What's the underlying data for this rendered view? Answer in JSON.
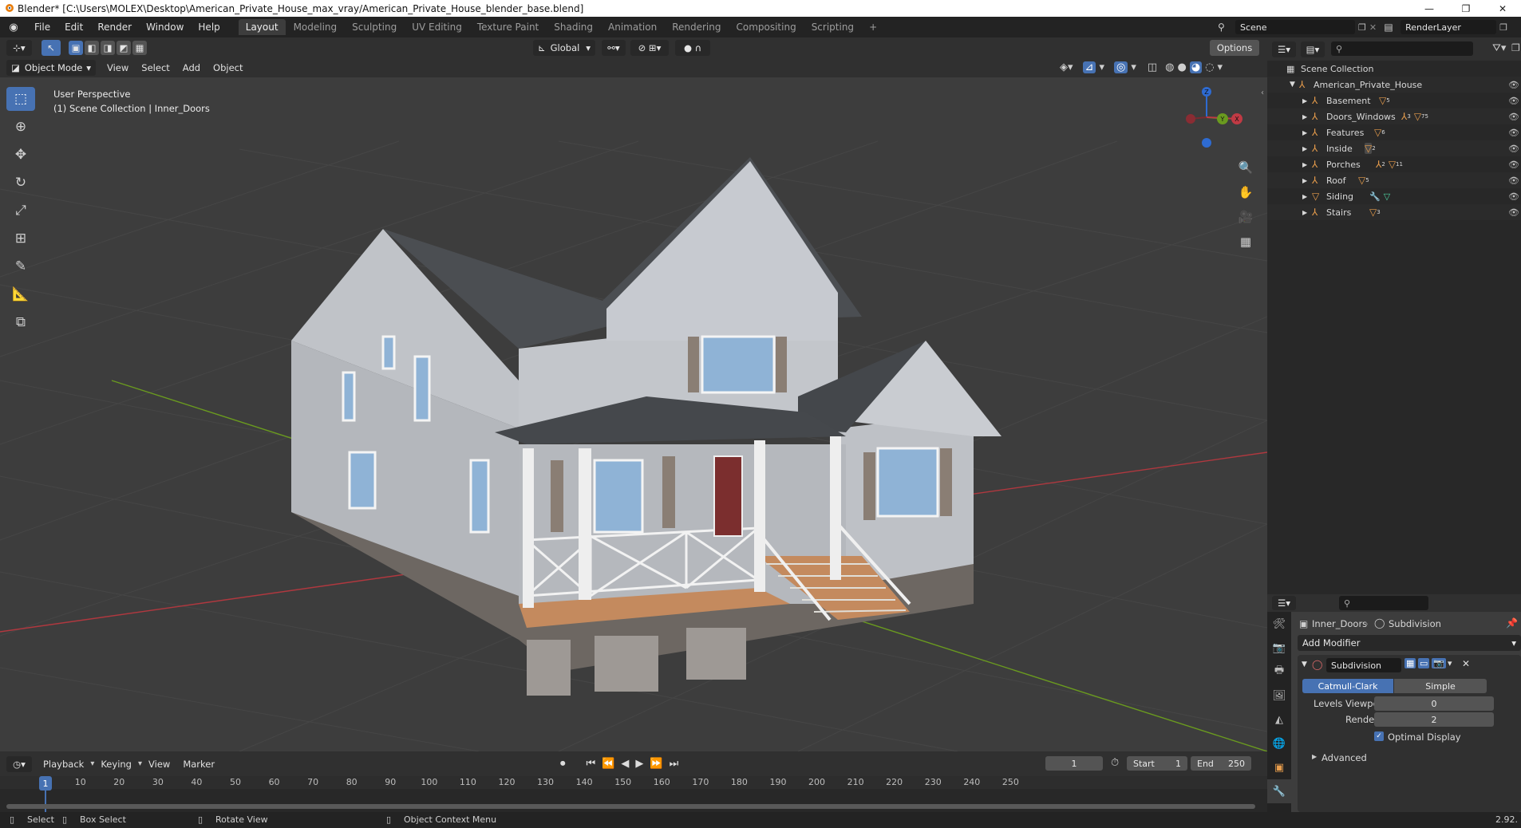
{
  "window": {
    "title": "Blender* [C:\\Users\\MOLEX\\Desktop\\American_Private_House_max_vray/American_Private_House_blender_base.blend]",
    "controls": [
      "—",
      "❐",
      "✕"
    ]
  },
  "menubar": {
    "items": [
      "File",
      "Edit",
      "Render",
      "Window",
      "Help"
    ],
    "workspaces": [
      "Layout",
      "Modeling",
      "Sculpting",
      "UV Editing",
      "Texture Paint",
      "Shading",
      "Animation",
      "Rendering",
      "Compositing",
      "Scripting"
    ],
    "active_workspace": "Layout",
    "add_tab": "+",
    "scene": "Scene",
    "render_layer": "RenderLayer"
  },
  "viewport_header": {
    "orientation": "Global",
    "options": "Options",
    "mode": "Object Mode",
    "menus": [
      "View",
      "Select",
      "Add",
      "Object"
    ]
  },
  "viewport": {
    "perspective": "User Perspective",
    "collection_info": "(1) Scene Collection | Inner_Doors",
    "gizmo": {
      "x": "X",
      "y": "Y",
      "z": "Z"
    },
    "colors": {
      "background": "#3d3d3d",
      "grid": "#484848",
      "x_axis": "#b0383f",
      "y_axis": "#6a9a1f",
      "accent": "#4772b3"
    }
  },
  "tools": [
    "select-box",
    "cursor",
    "move",
    "rotate",
    "scale",
    "transform",
    "annotate",
    "measure",
    "add-cube"
  ],
  "nav_tools": [
    "zoom",
    "pan",
    "camera",
    "ortho-grid"
  ],
  "timeline": {
    "menus": [
      "Playback",
      "Keying",
      "View",
      "Marker"
    ],
    "current_frame": "1",
    "start_label": "Start",
    "start": "1",
    "end_label": "End",
    "end": "250",
    "ticks": [
      "10",
      "20",
      "30",
      "40",
      "50",
      "60",
      "70",
      "80",
      "90",
      "100",
      "110",
      "120",
      "130",
      "140",
      "150",
      "160",
      "170",
      "180",
      "190",
      "200",
      "210",
      "220",
      "230",
      "240",
      "250"
    ]
  },
  "statusbar": {
    "select": "Select",
    "box_select": "Box Select",
    "rotate_view": "Rotate View",
    "context_menu": "Object Context Menu",
    "version": "2.92."
  },
  "outliner": {
    "scene_collection": "Scene Collection",
    "root": "American_Private_House",
    "children": [
      {
        "name": "Basement",
        "badge": "5"
      },
      {
        "name": "Doors_Windows",
        "badge": "3",
        "badge2": "75"
      },
      {
        "name": "Features",
        "badge": "6"
      },
      {
        "name": "Inside",
        "badge": "2"
      },
      {
        "name": "Porches",
        "badge": "2",
        "badge2": "11"
      },
      {
        "name": "Roof",
        "badge": "5"
      },
      {
        "name": "Siding",
        "badge": ""
      },
      {
        "name": "Stairs",
        "badge": "3"
      }
    ]
  },
  "properties": {
    "object": "Inner_Doors",
    "modifier_context": "Subdivision",
    "add_modifier": "Add Modifier",
    "modifier_name": "Subdivision",
    "type_catmull": "Catmull-Clark",
    "type_simple": "Simple",
    "levels_viewport_label": "Levels Viewport",
    "levels_viewport": "0",
    "render_label": "Render",
    "render": "2",
    "optimal_display": "Optimal Display",
    "advanced": "Advanced"
  }
}
